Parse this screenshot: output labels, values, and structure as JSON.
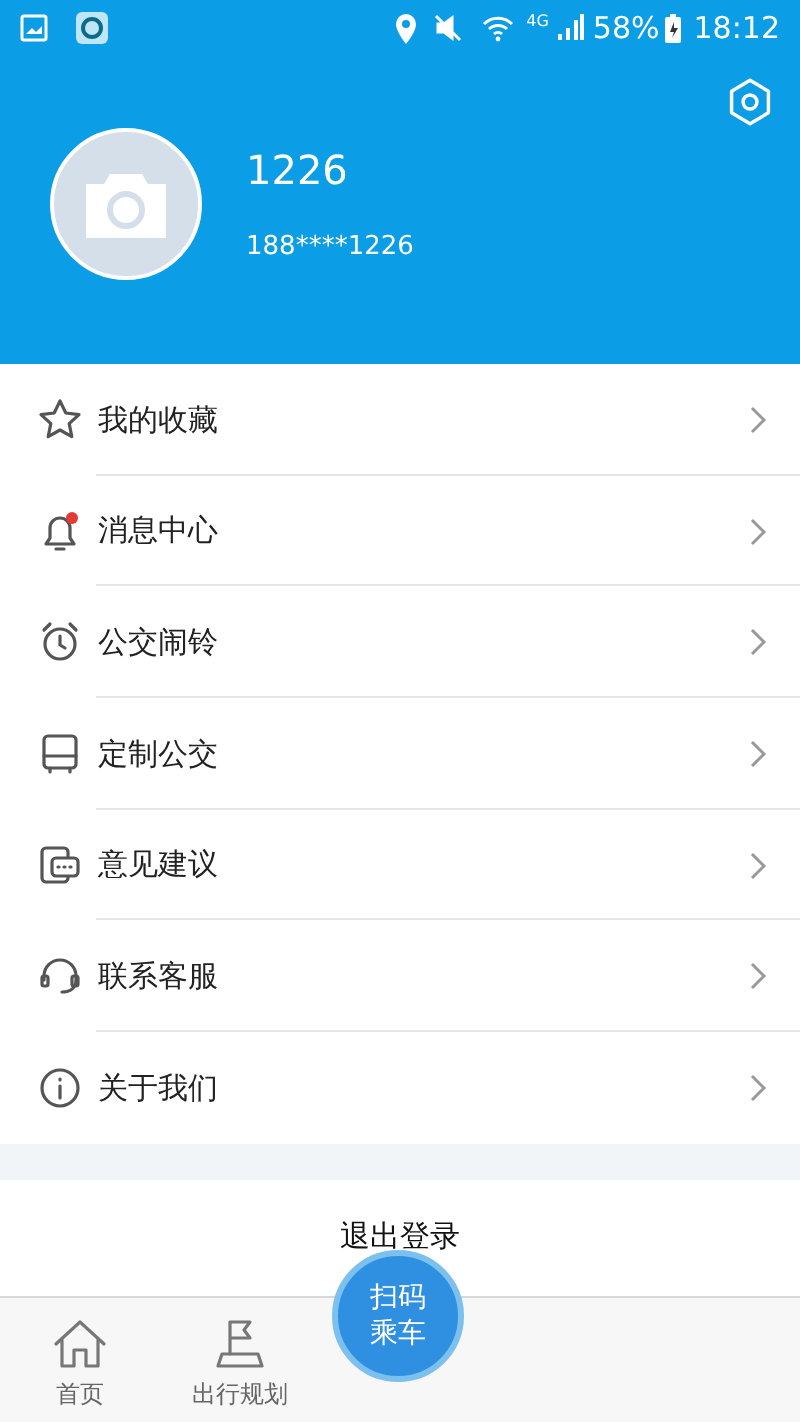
{
  "status_bar": {
    "network": "4G",
    "battery": "58%",
    "time": "18:12"
  },
  "profile": {
    "name": "1226",
    "phone": "188****1226"
  },
  "menu": [
    {
      "kind": "star",
      "label": "我的收藏"
    },
    {
      "kind": "bell",
      "label": "消息中心",
      "badge": true
    },
    {
      "kind": "alarm",
      "label": "公交闹铃"
    },
    {
      "kind": "bus",
      "label": "定制公交"
    },
    {
      "kind": "feedback",
      "label": "意见建议"
    },
    {
      "kind": "headset",
      "label": "联系客服"
    },
    {
      "kind": "info",
      "label": "关于我们"
    }
  ],
  "logout": "退出登录",
  "tabs": [
    {
      "kind": "home",
      "label": "首页"
    },
    {
      "kind": "flag",
      "label": "出行规划"
    }
  ],
  "scan_button": [
    "扫码",
    "乘车"
  ]
}
